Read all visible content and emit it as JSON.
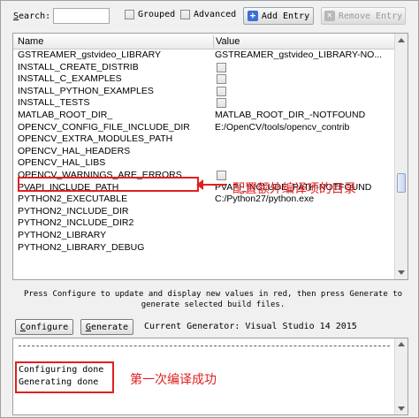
{
  "toolbar": {
    "search_label_prefix": "S",
    "search_label_rest": "earch:",
    "search_value": "",
    "grouped_label": "Grouped",
    "advanced_label": "Advanced",
    "add_entry_label": "Add Entry",
    "remove_entry_label": "Remove Entry"
  },
  "table": {
    "columns": [
      "Name",
      "Value"
    ],
    "rows": [
      {
        "name": "GSTREAMER_gstvideo_LIBRARY",
        "value": "GSTREAMER_gstvideo_LIBRARY-NO...",
        "type": "text"
      },
      {
        "name": "INSTALL_CREATE_DISTRIB",
        "value": "",
        "type": "checkbox"
      },
      {
        "name": "INSTALL_C_EXAMPLES",
        "value": "",
        "type": "checkbox"
      },
      {
        "name": "INSTALL_PYTHON_EXAMPLES",
        "value": "",
        "type": "checkbox"
      },
      {
        "name": "INSTALL_TESTS",
        "value": "",
        "type": "checkbox"
      },
      {
        "name": "MATLAB_ROOT_DIR_",
        "value": "MATLAB_ROOT_DIR_-NOTFOUND",
        "type": "text"
      },
      {
        "name": "OPENCV_CONFIG_FILE_INCLUDE_DIR",
        "value": "E:/OpenCV/tools/opencv_contrib",
        "type": "text"
      },
      {
        "name": "OPENCV_EXTRA_MODULES_PATH",
        "value": "",
        "type": "text"
      },
      {
        "name": "OPENCV_HAL_HEADERS",
        "value": "",
        "type": "text"
      },
      {
        "name": "OPENCV_HAL_LIBS",
        "value": "",
        "type": "text"
      },
      {
        "name": "OPENCV_WARNINGS_ARE_ERRORS",
        "value": "",
        "type": "checkbox"
      },
      {
        "name": "PVAPI_INCLUDE_PATH",
        "value": "PVAPI_INCLUDE_PATH-NOTFOUND",
        "type": "text"
      },
      {
        "name": "PYTHON2_EXECUTABLE",
        "value": "C:/Python27/python.exe",
        "type": "text"
      },
      {
        "name": "PYTHON2_INCLUDE_DIR",
        "value": "",
        "type": "text"
      },
      {
        "name": "PYTHON2_INCLUDE_DIR2",
        "value": "",
        "type": "text"
      },
      {
        "name": "PYTHON2_LIBRARY",
        "value": "",
        "type": "text"
      },
      {
        "name": "PYTHON2_LIBRARY_DEBUG",
        "value": "",
        "type": "text"
      }
    ]
  },
  "annotations": {
    "extra_modules_note": "配置额外编译项的目录",
    "configure_success_note": "第一次编译成功"
  },
  "hint_line1": "Press Configure to update and display new values in red, then press Generate to",
  "hint_line2": "generate selected build files.",
  "buttons": {
    "configure_prefix": "C",
    "configure_rest": "onfigure",
    "generate_prefix": "G",
    "generate_rest": "enerate"
  },
  "generator_label": "Current Generator: Visual Studio 14 2015",
  "output": {
    "lines": [
      "Configuring done",
      "Generating done"
    ]
  },
  "colors": {
    "annotation": "#e02020",
    "accent": "#3a6fd8"
  }
}
